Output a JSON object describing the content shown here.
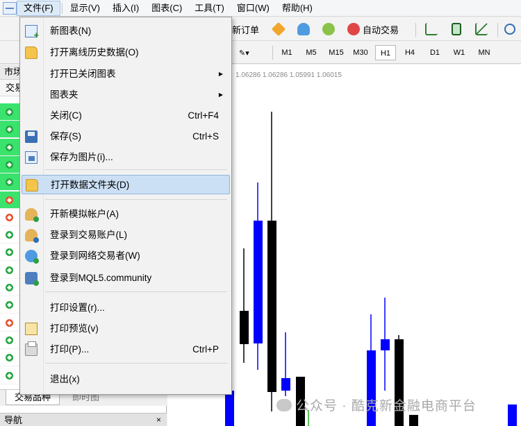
{
  "menubar": {
    "items": [
      "文件(F)",
      "显示(V)",
      "插入(I)",
      "图表(C)",
      "工具(T)",
      "窗口(W)",
      "帮助(H)"
    ]
  },
  "toolbar": {
    "new_order": "新订单",
    "auto_trade": "自动交易"
  },
  "timeframes": [
    "M1",
    "M5",
    "M15",
    "M30",
    "H1",
    "H4",
    "D1",
    "W1",
    "MN"
  ],
  "timeframe_selected": "H1",
  "left_panel": {
    "title": "市场",
    "header": "交易",
    "tabs": [
      "交易品种",
      "即时图"
    ],
    "navigator_title": "导航",
    "navigator_close": "×"
  },
  "chart": {
    "ohlc_text": "1.06286 1.06286 1.05991 1.06015",
    "colors": {
      "bull": "#0000ff",
      "bear": "#000000"
    }
  },
  "file_menu": {
    "items": [
      {
        "label": "新图表(N)",
        "shortcut": "",
        "icon": "new-chart-icon"
      },
      {
        "label": "打开离线历史数据(O)",
        "shortcut": "",
        "icon": "folder-icon"
      },
      {
        "label": "打开已关闭图表",
        "shortcut": "",
        "icon": "",
        "submenu": true
      },
      {
        "label": "图表夹",
        "shortcut": "",
        "icon": "",
        "submenu": true
      },
      {
        "label": "关闭(C)",
        "shortcut": "Ctrl+F4",
        "icon": ""
      },
      {
        "label": "保存(S)",
        "shortcut": "Ctrl+S",
        "icon": "save-icon"
      },
      {
        "label": "保存为图片(i)...",
        "shortcut": "",
        "icon": "save-image-icon"
      },
      {
        "label": "打开数据文件夹(D)",
        "shortcut": "",
        "icon": "folder-icon"
      },
      {
        "label": "开新模拟帐户(A)",
        "shortcut": "",
        "icon": "new-account-icon"
      },
      {
        "label": "登录到交易账户(L)",
        "shortcut": "",
        "icon": "login-icon"
      },
      {
        "label": "登录到网络交易者(W)",
        "shortcut": "",
        "icon": "web-trader-icon"
      },
      {
        "label": "登录到MQL5.community",
        "shortcut": "",
        "icon": "mql5-icon"
      },
      {
        "label": "打印设置(r)...",
        "shortcut": "",
        "icon": ""
      },
      {
        "label": "打印预览(v)",
        "shortcut": "",
        "icon": "print-preview-icon"
      },
      {
        "label": "打印(P)...",
        "shortcut": "Ctrl+P",
        "icon": "printer-icon"
      },
      {
        "label": "退出(x)",
        "shortcut": "",
        "icon": ""
      }
    ]
  },
  "watermark": "公众号 · 酷克新金融电商平台"
}
